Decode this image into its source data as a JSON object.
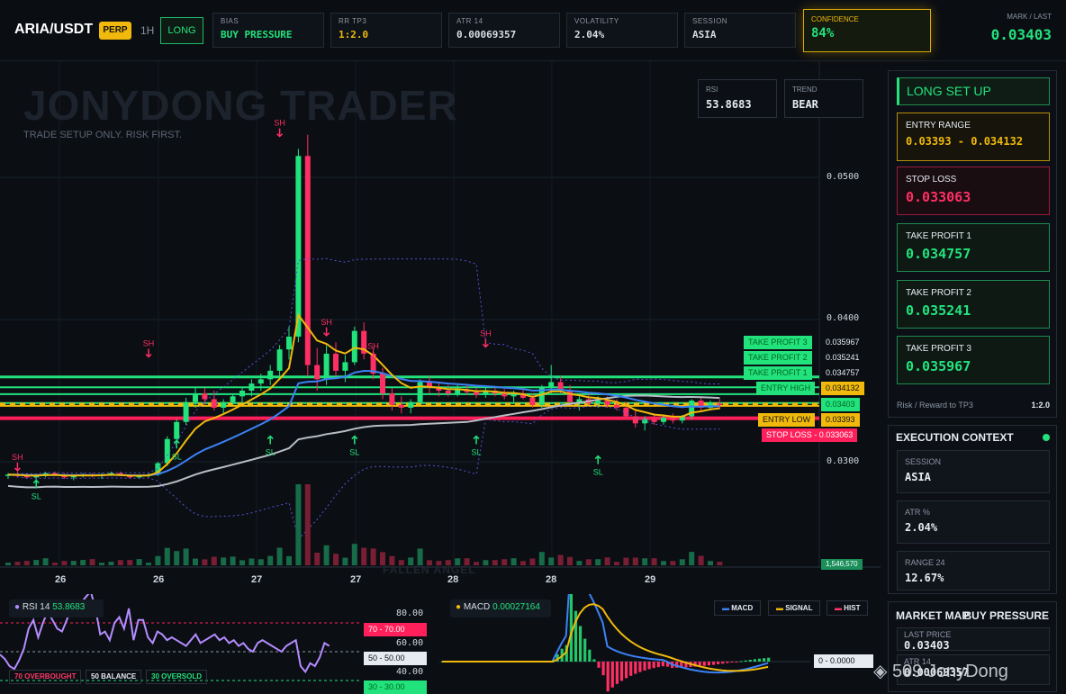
{
  "header": {
    "symbol": "ARIA/USDT",
    "market_type": "PERP",
    "timeframe": "1H",
    "direction": "LONG",
    "stats": [
      {
        "label": "BIAS",
        "value": "BUY PRESSURE",
        "color": "#22e27c"
      },
      {
        "label": "RR TP3",
        "value": "1:2.0",
        "color": "#f0b90b"
      },
      {
        "label": "ATR 14",
        "value": "0.00069357",
        "color": "#e6ebf2"
      },
      {
        "label": "VOLATILITY",
        "value": "2.04%",
        "color": "#e6ebf2"
      },
      {
        "label": "SESSION",
        "value": "ASIA",
        "color": "#e6ebf2"
      }
    ],
    "confidence": {
      "label": "CONFIDENCE",
      "value": "84%"
    },
    "mark": {
      "label": "MARK / LAST",
      "value": "0.03403"
    }
  },
  "chart": {
    "watermark": "JONYDONG TRADER",
    "subtitle": "TRADE SETUP ONLY. RISK FIRST.",
    "rsi_box": {
      "label": "RSI",
      "value": "53.8683"
    },
    "trend_box": {
      "label": "TREND",
      "value": "BEAR"
    },
    "price_scale": [
      "0.0500",
      "0.0400",
      "0.0300"
    ],
    "x_labels": [
      "26",
      "26",
      "27",
      "27",
      "28",
      "28",
      "29"
    ],
    "volume_label": "1,546,570",
    "fallen_angel": "FALLEN ANGEL",
    "level_tags": [
      {
        "name": "TAKE PROFIT 3",
        "value": "0.035967",
        "color": "#22e27c"
      },
      {
        "name": "TAKE PROFIT 2",
        "value": "0.035241",
        "color": "#22e27c"
      },
      {
        "name": "TAKE PROFIT 1",
        "value": "0.034757",
        "color": "#22e27c"
      },
      {
        "name": "ENTRY HIGH",
        "value": "0.034132",
        "color": "#f0b90b"
      },
      {
        "name": "ENTRY LOW",
        "value": "0.03393",
        "color": "#f0b90b"
      },
      {
        "name": "STOP LOSS",
        "value": "0.033063",
        "color": "#ff1f5a"
      }
    ],
    "last_price_tag": "0.03403",
    "signal_labels": {
      "swing_high": "SH",
      "stop_loss": "SL"
    }
  },
  "chart_data": {
    "type": "candlestick",
    "xlabel": "",
    "ylabel": "",
    "ylim": [
      0.0265,
      0.0565
    ],
    "x_tick_labels": [
      "26",
      "26",
      "27",
      "27",
      "28",
      "28",
      "29"
    ],
    "levels": {
      "tp3": 0.035967,
      "tp2": 0.035241,
      "tp1": 0.034757,
      "entry_high": 0.034132,
      "entry_low": 0.03393,
      "stop_loss": 0.033063,
      "last": 0.03403
    },
    "candles": [
      [
        0.029,
        0.0292,
        0.0288,
        0.0291
      ],
      [
        0.0291,
        0.0293,
        0.0289,
        0.029
      ],
      [
        0.029,
        0.0292,
        0.0288,
        0.0289
      ],
      [
        0.0289,
        0.0291,
        0.0287,
        0.029
      ],
      [
        0.029,
        0.0293,
        0.0289,
        0.0292
      ],
      [
        0.0292,
        0.0293,
        0.029,
        0.0291
      ],
      [
        0.0291,
        0.0292,
        0.0288,
        0.0289
      ],
      [
        0.0289,
        0.0291,
        0.0287,
        0.029
      ],
      [
        0.029,
        0.0292,
        0.0289,
        0.0291
      ],
      [
        0.0291,
        0.0292,
        0.0289,
        0.029
      ],
      [
        0.029,
        0.0292,
        0.0288,
        0.0291
      ],
      [
        0.0291,
        0.0293,
        0.029,
        0.0292
      ],
      [
        0.0292,
        0.0293,
        0.029,
        0.029
      ],
      [
        0.029,
        0.0291,
        0.0288,
        0.0289
      ],
      [
        0.0289,
        0.0291,
        0.0288,
        0.029
      ],
      [
        0.029,
        0.0292,
        0.0289,
        0.0291
      ],
      [
        0.0291,
        0.03,
        0.029,
        0.0299
      ],
      [
        0.0299,
        0.0318,
        0.0297,
        0.0316
      ],
      [
        0.0316,
        0.033,
        0.0314,
        0.0328
      ],
      [
        0.0328,
        0.0345,
        0.0326,
        0.0342
      ],
      [
        0.0342,
        0.0352,
        0.0338,
        0.0348
      ],
      [
        0.0348,
        0.0352,
        0.034,
        0.0344
      ],
      [
        0.0344,
        0.035,
        0.0336,
        0.0338
      ],
      [
        0.0338,
        0.0344,
        0.0334,
        0.0342
      ],
      [
        0.0342,
        0.0348,
        0.034,
        0.0346
      ],
      [
        0.0346,
        0.0352,
        0.0342,
        0.035
      ],
      [
        0.035,
        0.0358,
        0.0346,
        0.0355
      ],
      [
        0.0355,
        0.0362,
        0.035,
        0.0358
      ],
      [
        0.0358,
        0.0368,
        0.0354,
        0.0364
      ],
      [
        0.0364,
        0.0382,
        0.036,
        0.0379
      ],
      [
        0.0379,
        0.0395,
        0.0372,
        0.0388
      ],
      [
        0.0388,
        0.052,
        0.0384,
        0.0515
      ],
      [
        0.0515,
        0.053,
        0.036,
        0.0368
      ],
      [
        0.0368,
        0.038,
        0.035,
        0.0358
      ],
      [
        0.0358,
        0.0382,
        0.0354,
        0.0376
      ],
      [
        0.0376,
        0.0384,
        0.036,
        0.0364
      ],
      [
        0.0364,
        0.0375,
        0.0356,
        0.037
      ],
      [
        0.037,
        0.0395,
        0.0368,
        0.0392
      ],
      [
        0.0392,
        0.0398,
        0.0372,
        0.0376
      ],
      [
        0.0376,
        0.038,
        0.0358,
        0.0362
      ],
      [
        0.0362,
        0.0366,
        0.0344,
        0.0348
      ],
      [
        0.0348,
        0.0352,
        0.0336,
        0.034
      ],
      [
        0.034,
        0.0346,
        0.0334,
        0.0338
      ],
      [
        0.0338,
        0.0344,
        0.0334,
        0.0342
      ],
      [
        0.0342,
        0.0358,
        0.034,
        0.0356
      ],
      [
        0.0356,
        0.036,
        0.0348,
        0.0352
      ],
      [
        0.0352,
        0.0356,
        0.0346,
        0.035
      ],
      [
        0.035,
        0.0354,
        0.0346,
        0.0348
      ],
      [
        0.0348,
        0.0354,
        0.0346,
        0.0351
      ],
      [
        0.0351,
        0.0354,
        0.0347,
        0.0349
      ],
      [
        0.0349,
        0.0352,
        0.0345,
        0.0347
      ],
      [
        0.0347,
        0.0352,
        0.0345,
        0.035
      ],
      [
        0.035,
        0.0353,
        0.0346,
        0.0348
      ],
      [
        0.0348,
        0.0351,
        0.0344,
        0.0346
      ],
      [
        0.0346,
        0.035,
        0.0342,
        0.0348
      ],
      [
        0.0348,
        0.0352,
        0.0344,
        0.0345
      ],
      [
        0.0345,
        0.0348,
        0.0338,
        0.034
      ],
      [
        0.034,
        0.0354,
        0.0338,
        0.0352
      ],
      [
        0.0352,
        0.0368,
        0.0348,
        0.0356
      ],
      [
        0.0356,
        0.036,
        0.0348,
        0.035
      ],
      [
        0.035,
        0.0354,
        0.034,
        0.0342
      ],
      [
        0.0342,
        0.0346,
        0.0336,
        0.0344
      ],
      [
        0.0344,
        0.0348,
        0.034,
        0.0341
      ],
      [
        0.0341,
        0.0346,
        0.0338,
        0.0343
      ],
      [
        0.0343,
        0.0346,
        0.0338,
        0.034
      ],
      [
        0.034,
        0.0344,
        0.0336,
        0.0338
      ],
      [
        0.0338,
        0.0342,
        0.033,
        0.0332
      ],
      [
        0.0332,
        0.0336,
        0.0324,
        0.0327
      ],
      [
        0.0327,
        0.0332,
        0.0322,
        0.033
      ],
      [
        0.033,
        0.0334,
        0.0326,
        0.0328
      ],
      [
        0.0328,
        0.0333,
        0.0326,
        0.0331
      ],
      [
        0.0331,
        0.0334,
        0.0327,
        0.0329
      ],
      [
        0.0329,
        0.0333,
        0.0327,
        0.0332
      ],
      [
        0.0332,
        0.0344,
        0.033,
        0.0343
      ],
      [
        0.0343,
        0.0346,
        0.0336,
        0.0338
      ],
      [
        0.0338,
        0.0343,
        0.0336,
        0.0341
      ],
      [
        0.0341,
        0.0344,
        0.0337,
        0.034
      ]
    ]
  },
  "long_setup": {
    "title": "LONG SET UP",
    "entry": {
      "label": "ENTRY RANGE",
      "value": "0.03393 - 0.034132"
    },
    "stop": {
      "label": "STOP LOSS",
      "value": "0.033063"
    },
    "tp1": {
      "label": "TAKE PROFIT 1",
      "value": "0.034757"
    },
    "tp2": {
      "label": "TAKE PROFIT 2",
      "value": "0.035241"
    },
    "tp3": {
      "label": "TAKE PROFIT 3",
      "value": "0.035967"
    },
    "rr_label": "Risk / Reward to TP3",
    "rr_value": "1:2.0"
  },
  "context": {
    "title": "EXECUTION CONTEXT",
    "session": {
      "label": "SESSION",
      "value": "ASIA"
    },
    "atr": {
      "label": "ATR %",
      "value": "2.04%"
    },
    "range": {
      "label": "RANGE 24",
      "value": "12.67%"
    }
  },
  "market_map": {
    "title": "MARKET MAP",
    "bias": "BUY PRESSURE",
    "last_price_label": "LAST PRICE",
    "last_price": "0.03403",
    "atr_label": "ATR 14",
    "atr_value": "0.00069357"
  },
  "rsi_panel": {
    "label": "RSI 14",
    "value": "53.8683",
    "scale": [
      "80.00",
      "60.00",
      "40.00"
    ],
    "ob": {
      "label": "70 OVERBOUGHT",
      "tag": "70",
      "val": "70.00"
    },
    "bal": {
      "label": "50 BALANCE",
      "tag": "50",
      "val": "50.00"
    },
    "os": {
      "label": "30 OVERSOLD",
      "tag": "30",
      "val": "30.00"
    }
  },
  "macd_panel": {
    "label": "MACD",
    "value": "0.00027164",
    "legend": [
      "MACD",
      "SIGNAL",
      "HIST"
    ],
    "zero_tag": "0",
    "zero_val": "0.0000"
  },
  "credit": "509 JonyDong"
}
